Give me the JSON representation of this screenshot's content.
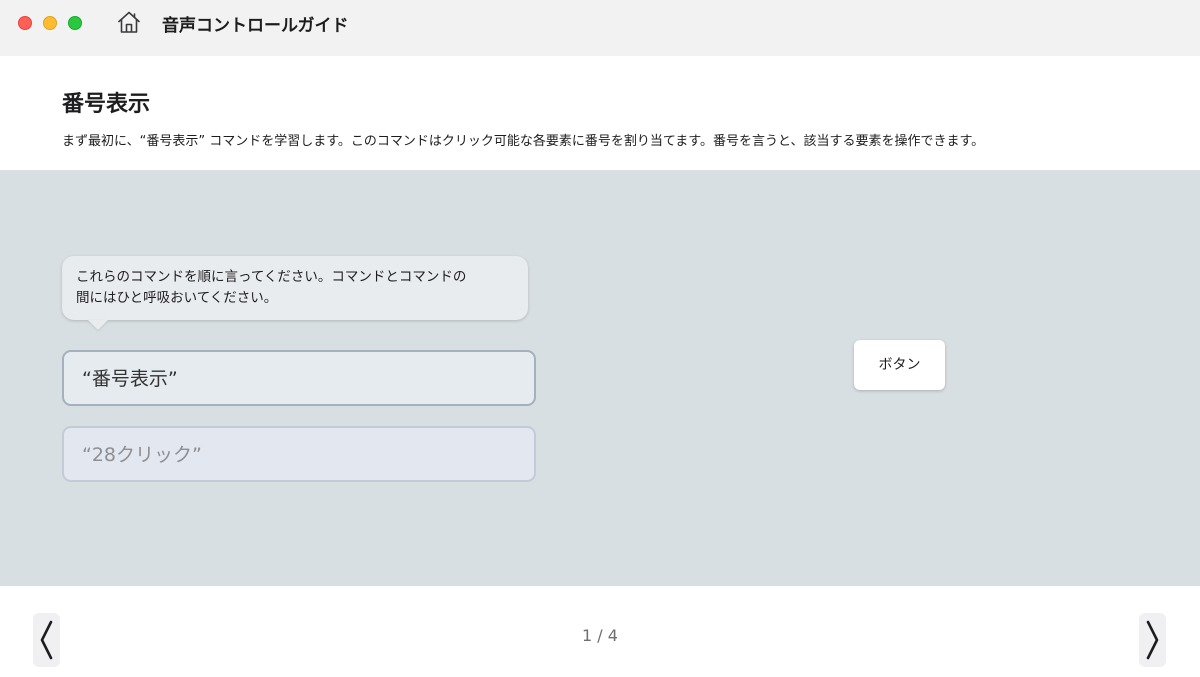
{
  "window": {
    "app_title": "音声コントロールガイド",
    "icons": {
      "home": "home-icon",
      "close": "close-button",
      "minimize": "minimize-button",
      "zoom": "zoom-button"
    },
    "colors": {
      "close": "#fe5f57",
      "minimize": "#febc2e",
      "zoom": "#28c840"
    }
  },
  "header": {
    "title": "番号表示",
    "description": "まず最初に、“番号表示” コマンドを学習します。このコマンドはクリック可能な各要素に番号を割り当てます。番号を言うと、該当する要素を操作できます。"
  },
  "main": {
    "tooltip_lines": [
      "これらのコマンドを順に言ってください。コマンドとコマンドの",
      "間にはひと呼吸おいてください。"
    ],
    "commands": [
      {
        "label": "“番号表示”",
        "state": "active"
      },
      {
        "label": "“28クリック”",
        "state": "pending"
      }
    ],
    "demo_button_label": "ボタン",
    "background_color": "#d8dfe2"
  },
  "footer": {
    "page_indicator": "1 / 4",
    "current_page": 1,
    "total_pages": 4,
    "icons": {
      "prev": "chevron-left-icon",
      "next": "chevron-right-icon"
    }
  }
}
